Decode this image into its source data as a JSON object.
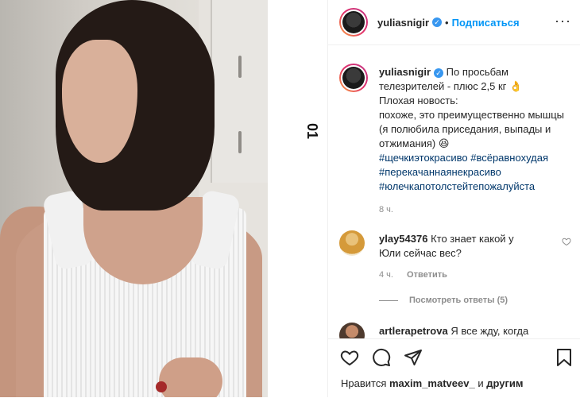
{
  "post": {
    "username": "yuliasnigir",
    "verified_mark": "✓",
    "separator": "•",
    "follow_label": "Подписаться",
    "more_label": "···",
    "carousel_indicator": "01"
  },
  "caption": {
    "username": "yuliasnigir",
    "text_1": "По просьбам телезрителей - плюс 2,5 кг 👌",
    "text_2": "Плохая новость:",
    "text_3": "похоже, это преимущественно мышцы (я полюбила приседания, выпады и отжимания) 😆",
    "hashtags": [
      "#щечкиэтокрасиво",
      "#всёравнохудая",
      "#перекачаннаянекрасиво",
      "#юлечкапотолстейтепожалуйста"
    ],
    "time": "8 ч."
  },
  "comments": [
    {
      "username": "ylay54376",
      "text": "Кто знает какой у Юли сейчас вес?",
      "time": "4 ч.",
      "reply_label": "Ответить"
    },
    {
      "username": "artlerapetrova",
      "text": "Я все жду, когда"
    }
  ],
  "view_replies": "Посмотреть ответы (5)",
  "likes": {
    "prefix": "Нравится",
    "user": "maxim_matveev_",
    "and": "и",
    "others": "другим"
  },
  "icons": {
    "like": "heart-icon",
    "comment": "comment-icon",
    "share": "share-icon",
    "save": "bookmark-icon"
  },
  "colors": {
    "follow_blue": "#0095f6",
    "verified_blue": "#3897f0",
    "hashtag": "#00376b",
    "muted": "#8e8e8e"
  }
}
